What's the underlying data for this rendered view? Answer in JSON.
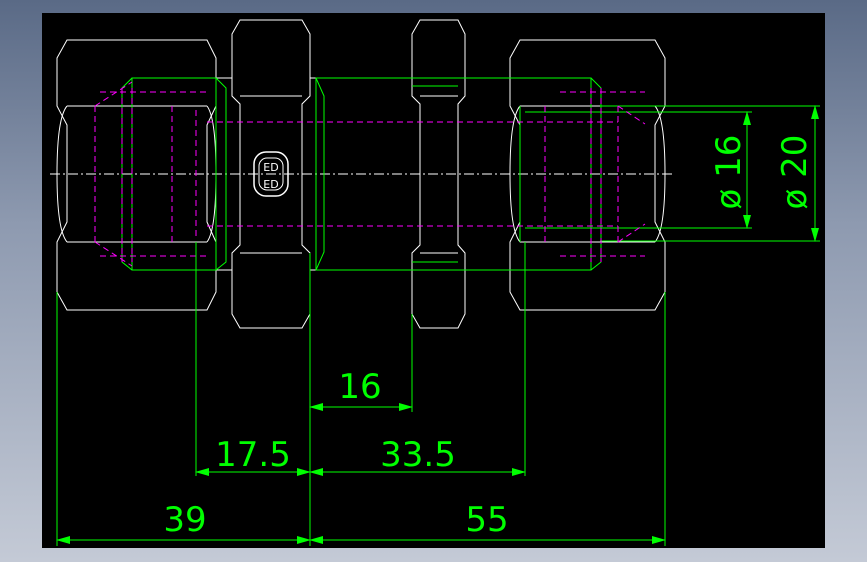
{
  "drawing": {
    "background_color": "#000000",
    "colors": {
      "outline": "#ffffff",
      "hidden": "#ff00ff",
      "dimension": "#00ff00",
      "centerline": "#ffffff"
    },
    "logo": {
      "name": "logo-stamp",
      "text": "ED"
    },
    "dimensions": {
      "d16": "16",
      "d17_5": "17.5",
      "d33_5": "33.5",
      "d39": "39",
      "d55": "55",
      "dia16": "ø 16",
      "dia20": "ø 20"
    }
  }
}
